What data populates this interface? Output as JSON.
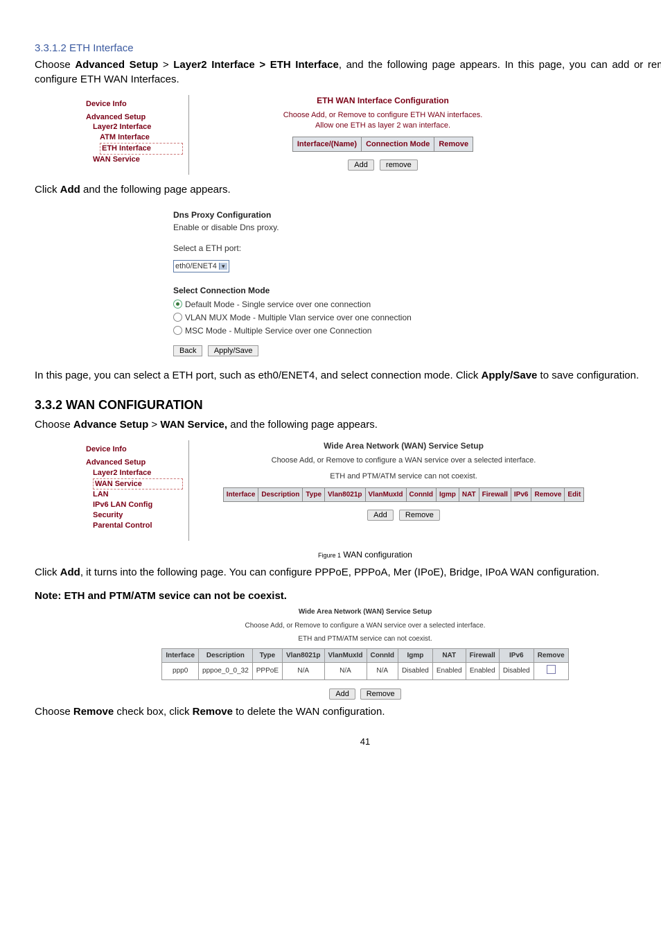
{
  "s1": {
    "title": "3.3.1.2 ETH Interface",
    "p1a": "Choose ",
    "p1b": "Advanced Setup",
    "p1c": " > ",
    "p1d": "Layer2 Interface > ETH Interface",
    "p1e": ", and the following page appears. In this page, you can add or remove to configure ETH WAN Interfaces."
  },
  "fig1": {
    "side_dev": "Device Info",
    "side_adv": "Advanced Setup",
    "side_l2": "Layer2 Interface",
    "side_atm": "ATM Interface",
    "side_eth": "ETH Interface",
    "side_wan": "WAN Service",
    "title": "ETH WAN Interface Configuration",
    "msg1": "Choose Add, or Remove to configure ETH WAN interfaces.",
    "msg2": "Allow one ETH as layer 2 wan interface.",
    "col1": "Interface/(Name)",
    "col2": "Connection Mode",
    "col3": "Remove",
    "btn_add": "Add",
    "btn_rem": "remove"
  },
  "s2": {
    "p": "Click ",
    "pb": "Add",
    "pc": " and the following page appears."
  },
  "dns": {
    "h": "Dns Proxy Configuration",
    "sub": "Enable or disable Dns proxy.",
    "sel_lbl": "Select a ETH port:",
    "sel_val": "eth0/ENET4",
    "scm": "Select Connection Mode",
    "r1": "Default Mode - Single service over one connection",
    "r2": "VLAN MUX Mode - Multiple Vlan service over one connection",
    "r3": "MSC Mode - Multiple Service over one Connection",
    "back": "Back",
    "apply": "Apply/Save"
  },
  "s3": {
    "p1": "In this page, you can select a ETH port, such as eth0/ENET4, and select connection mode. Click ",
    "p1b": "Apply/Save",
    "p1c": " to save configuration."
  },
  "wan": {
    "h": "3.3.2 WAN CONFIGURATION",
    "p1a": "Choose ",
    "p1b": "Advance Setup",
    "p1c": " > ",
    "p1d": "WAN Service,",
    "p1e": " and the following page appears."
  },
  "fig2": {
    "side_dev": "Device Info",
    "side_adv": "Advanced Setup",
    "side_l2": "Layer2 Interface",
    "side_wan": "WAN Service",
    "side_lan": "LAN",
    "side_v6": "IPv6 LAN Config",
    "side_sec": "Security",
    "side_par": "Parental Control",
    "title": "Wide Area Network (WAN) Service Setup",
    "msg1": "Choose Add, or Remove to configure a WAN service over a selected interface.",
    "msg2": "ETH and PTM/ATM service can not coexist.",
    "cols": [
      "Interface",
      "Description",
      "Type",
      "Vlan8021p",
      "VlanMuxId",
      "ConnId",
      "Igmp",
      "NAT",
      "Firewall",
      "IPv6",
      "Remove",
      "Edit"
    ],
    "btn_add": "Add",
    "btn_rem": "Remove"
  },
  "figcap": {
    "a": "Figure 1",
    "b": " WAN configuration"
  },
  "s4": {
    "p1a": "Click ",
    "p1b": "Add",
    "p1c": ", it turns into the following page. You can configure PPPoE, PPPoA, Mer (IPoE), Bridge, IPoA WAN configuration."
  },
  "note": "Note: ETH and PTM/ATM sevice can not be coexist.",
  "fig3": {
    "title": "Wide Area Network (WAN) Service Setup",
    "msg1": "Choose Add, or Remove to configure a WAN service over a selected interface.",
    "msg2": "ETH and PTM/ATM service can not coexist.",
    "cols": [
      "Interface",
      "Description",
      "Type",
      "Vlan8021p",
      "VlanMuxId",
      "ConnId",
      "Igmp",
      "NAT",
      "Firewall",
      "IPv6",
      "Remove"
    ],
    "row": [
      "ppp0",
      "pppoe_0_0_32",
      "PPPoE",
      "N/A",
      "N/A",
      "N/A",
      "Disabled",
      "Enabled",
      "Enabled",
      "Disabled",
      ""
    ],
    "btn_add": "Add",
    "btn_rem": "Remove"
  },
  "s5": {
    "p1a": "Choose ",
    "p1b": "Remove",
    "p1c": " check box, click ",
    "p1d": "Remove",
    "p1e": " to delete the WAN configuration."
  },
  "page": "41"
}
